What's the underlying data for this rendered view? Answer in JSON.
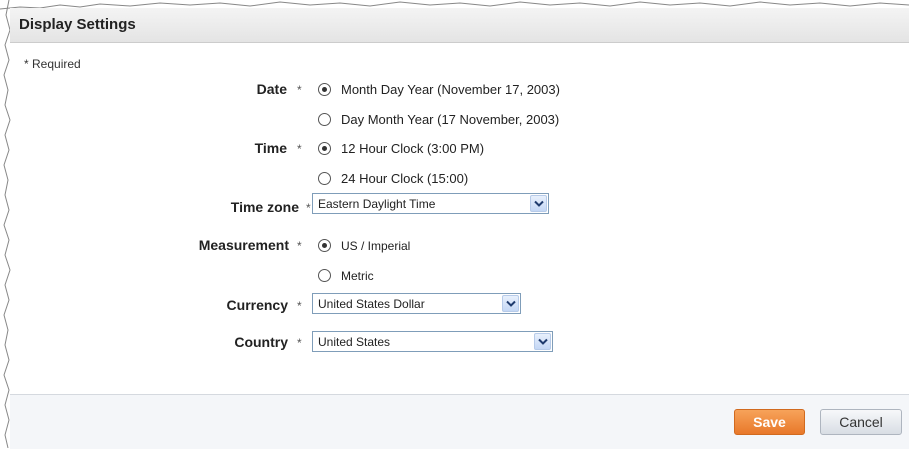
{
  "page": {
    "title": "Display Settings",
    "required_note": "* Required",
    "asterisk": "*"
  },
  "fields": {
    "date": {
      "label": "Date",
      "options": [
        {
          "label": "Month Day Year (November 17, 2003)",
          "checked": true
        },
        {
          "label": "Day Month Year (17 November, 2003)",
          "checked": false
        }
      ]
    },
    "time": {
      "label": "Time",
      "options": [
        {
          "label": "12 Hour Clock (3:00 PM)",
          "checked": true
        },
        {
          "label": "24 Hour Clock (15:00)",
          "checked": false
        }
      ]
    },
    "timezone": {
      "label": "Time zone",
      "value": "Eastern Daylight Time"
    },
    "measurement": {
      "label": "Measurement",
      "options": [
        {
          "label": "US / Imperial",
          "checked": true
        },
        {
          "label": "Metric",
          "checked": false
        }
      ]
    },
    "currency": {
      "label": "Currency",
      "value": "United States Dollar"
    },
    "country": {
      "label": "Country",
      "value": "United States"
    }
  },
  "buttons": {
    "save": "Save",
    "cancel": "Cancel"
  },
  "colors": {
    "save_button": "#e8782a",
    "header_bg": "#e9e9e9",
    "footer_bg": "#f4f6f9"
  }
}
